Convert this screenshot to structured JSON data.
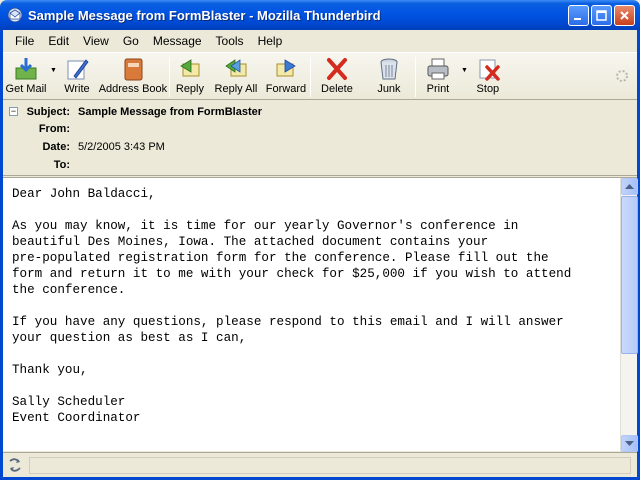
{
  "window": {
    "title": "Sample Message from FormBlaster - Mozilla Thunderbird"
  },
  "menu": [
    "File",
    "Edit",
    "View",
    "Go",
    "Message",
    "Tools",
    "Help"
  ],
  "toolbar": {
    "get_mail": "Get Mail",
    "write": "Write",
    "address_book": "Address Book",
    "reply": "Reply",
    "reply_all": "Reply All",
    "forward": "Forward",
    "delete": "Delete",
    "junk": "Junk",
    "print": "Print",
    "stop": "Stop"
  },
  "header": {
    "subject_label": "Subject:",
    "subject": "Sample Message from FormBlaster",
    "from_label": "From:",
    "from": "",
    "date_label": "Date:",
    "date": "5/2/2005 3:43 PM",
    "to_label": "To:",
    "to": ""
  },
  "message": {
    "body": "Dear John Baldacci,\n\nAs you may know, it is time for our yearly Governor's conference in\nbeautiful Des Moines, Iowa. The attached document contains your\npre-populated registration form for the conference. Please fill out the\nform and return it to me with your check for $25,000 if you wish to attend\nthe conference.\n\nIf you have any questions, please respond to this email and I will answer\nyour question as best as I can,\n\nThank you,\n\nSally Scheduler\nEvent Coordinator"
  },
  "colors": {
    "titlebar": "#0054e3",
    "chrome": "#ece9d8",
    "body_background": "#ffffff"
  }
}
